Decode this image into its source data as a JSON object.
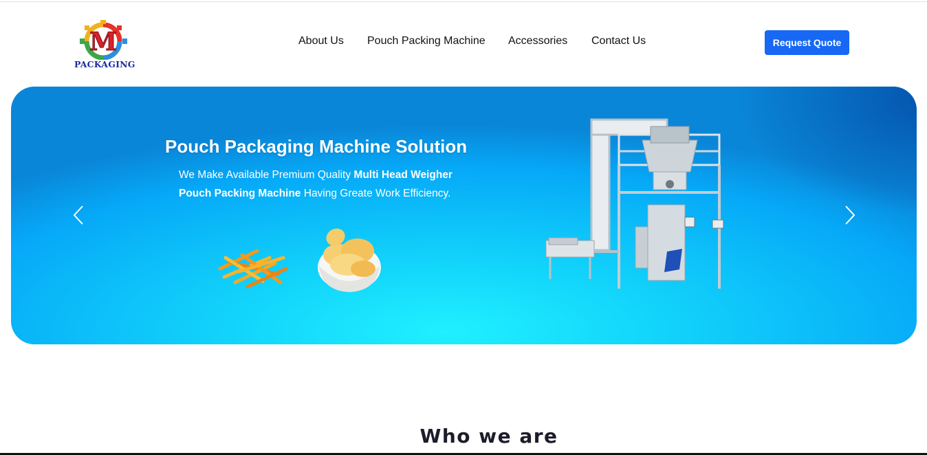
{
  "header": {
    "logo": {
      "letter": "M",
      "text": "PACKAGING"
    },
    "nav": [
      {
        "label": "About Us"
      },
      {
        "label": "Pouch Packing Machine"
      },
      {
        "label": "Accessories"
      },
      {
        "label": "Contact Us"
      }
    ],
    "cta_label": "Request Quote"
  },
  "hero": {
    "title": "Pouch Packaging Machine Solution",
    "subtitle_parts": [
      "We Make Available Premium Quality ",
      "Multi Head Weigher",
      "Pouch Packing Machine",
      " Having Greate Work Efficiency."
    ],
    "prev_icon": "chevron-left-icon",
    "next_icon": "chevron-right-icon"
  },
  "section": {
    "title": "Who we are"
  },
  "colors": {
    "accent": "#1668f5",
    "hero_blue": "#06a8f7",
    "hero_cyan": "#1ff0ff",
    "heading": "#1c1c2a"
  }
}
